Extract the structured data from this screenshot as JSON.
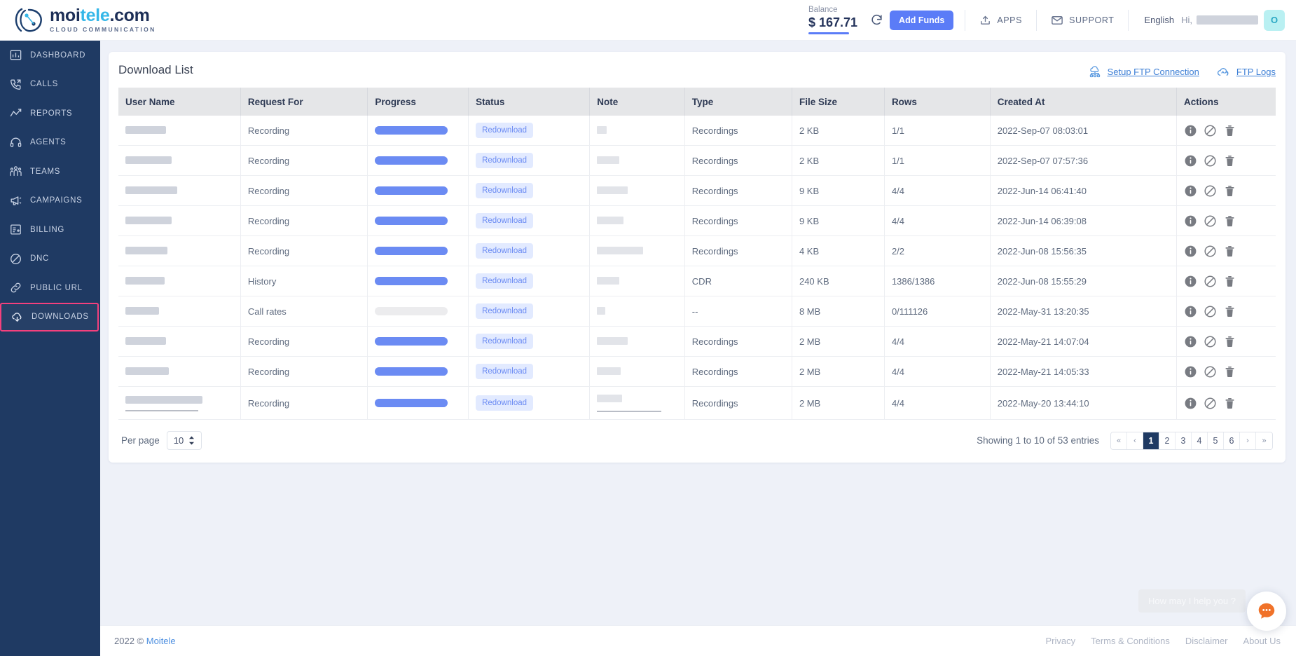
{
  "header": {
    "brand": {
      "name_part1": "moi",
      "name_part2": "tele",
      "name_part3": ".com",
      "tagline": "CLOUD COMMUNICATION"
    },
    "balance_label": "Balance",
    "balance_value": "$ 167.71",
    "refresh_icon": "refresh-icon",
    "add_funds_label": "Add Funds",
    "apps_label": "APPS",
    "apps_icon": "apps-upload-icon",
    "support_label": "SUPPORT",
    "support_icon": "envelope-icon",
    "language": "English",
    "greeting": "Hi,",
    "avatar_initial": "O",
    "accent_color": "#5b7cf7",
    "avatar_bg": "#b9f0f2"
  },
  "sidebar": {
    "active_highlight_color": "#f4407d",
    "background": "#1f3a63",
    "items": [
      {
        "label": "DASHBOARD",
        "icon": "dashboard-chart-icon",
        "active": false
      },
      {
        "label": "CALLS",
        "icon": "phone-call-icon",
        "active": false
      },
      {
        "label": "REPORTS",
        "icon": "line-chart-icon",
        "active": false
      },
      {
        "label": "AGENTS",
        "icon": "headset-icon",
        "active": false
      },
      {
        "label": "TEAMS",
        "icon": "people-group-icon",
        "active": false
      },
      {
        "label": "CAMPAIGNS",
        "icon": "megaphone-icon",
        "active": false
      },
      {
        "label": "BILLING",
        "icon": "invoice-icon",
        "active": false
      },
      {
        "label": "DNC",
        "icon": "ban-circle-icon",
        "active": false
      },
      {
        "label": "PUBLIC URL",
        "icon": "link-chain-icon",
        "active": false
      },
      {
        "label": "DOWNLOADS",
        "icon": "cloud-download-icon",
        "active": true
      }
    ]
  },
  "main": {
    "card_title": "Download List",
    "ftp_setup_label": "Setup FTP Connection",
    "ftp_setup_icon": "ftp-server-icon",
    "ftp_logs_label": "FTP Logs",
    "ftp_logs_icon": "cloud-sync-icon",
    "columns": [
      "User Name",
      "Request For",
      "Progress",
      "Status",
      "Note",
      "Type",
      "File Size",
      "Rows",
      "Created At",
      "Actions"
    ],
    "row_actions": [
      {
        "icon": "info-circle-icon",
        "title": "Info"
      },
      {
        "icon": "ban-circle-icon",
        "title": "Cancel"
      },
      {
        "icon": "trash-bin-icon",
        "title": "Delete"
      }
    ],
    "rows": [
      {
        "user_name": "",
        "user_redacted": true,
        "request_for": "Recording",
        "progress_percent": 100,
        "status": "Redownload",
        "note": "",
        "note_redacted": true,
        "type": "Recordings",
        "file_size": "2 KB",
        "rows": "1/1",
        "created_at": "2022-Sep-07 08:03:01"
      },
      {
        "user_name": "",
        "user_redacted": true,
        "request_for": "Recording",
        "progress_percent": 100,
        "status": "Redownload",
        "note": "",
        "note_redacted": true,
        "type": "Recordings",
        "file_size": "2 KB",
        "rows": "1/1",
        "created_at": "2022-Sep-07 07:57:36"
      },
      {
        "user_name": "",
        "user_redacted": true,
        "request_for": "Recording",
        "progress_percent": 100,
        "status": "Redownload",
        "note": "",
        "note_redacted": true,
        "type": "Recordings",
        "file_size": "9 KB",
        "rows": "4/4",
        "created_at": "2022-Jun-14 06:41:40"
      },
      {
        "user_name": "",
        "user_redacted": true,
        "request_for": "Recording",
        "progress_percent": 100,
        "status": "Redownload",
        "note": "",
        "note_redacted": true,
        "type": "Recordings",
        "file_size": "9 KB",
        "rows": "4/4",
        "created_at": "2022-Jun-14 06:39:08"
      },
      {
        "user_name": "",
        "user_redacted": true,
        "request_for": "Recording",
        "progress_percent": 100,
        "status": "Redownload",
        "note": "",
        "note_redacted": true,
        "type": "Recordings",
        "file_size": "4 KB",
        "rows": "2/2",
        "created_at": "2022-Jun-08 15:56:35"
      },
      {
        "user_name": "",
        "user_redacted": true,
        "request_for": "History",
        "progress_percent": 100,
        "status": "Redownload",
        "note": "",
        "note_redacted": true,
        "type": "CDR",
        "file_size": "240 KB",
        "rows": "1386/1386",
        "created_at": "2022-Jun-08 15:55:29"
      },
      {
        "user_name": "",
        "user_redacted": true,
        "request_for": "Call rates",
        "progress_percent": 0,
        "status": "Redownload",
        "note": "",
        "note_redacted": true,
        "type": "--",
        "file_size": "8 MB",
        "rows": "0/111126",
        "created_at": "2022-May-31 13:20:35"
      },
      {
        "user_name": "",
        "user_redacted": true,
        "request_for": "Recording",
        "progress_percent": 100,
        "status": "Redownload",
        "note": "",
        "note_redacted": true,
        "type": "Recordings",
        "file_size": "2 MB",
        "rows": "4/4",
        "created_at": "2022-May-21 14:07:04"
      },
      {
        "user_name": "",
        "user_redacted": true,
        "request_for": "Recording",
        "progress_percent": 100,
        "status": "Redownload",
        "note": "",
        "note_redacted": true,
        "type": "Recordings",
        "file_size": "2 MB",
        "rows": "4/4",
        "created_at": "2022-May-21 14:05:33"
      },
      {
        "user_name": "",
        "user_redacted": true,
        "request_for": "Recording",
        "progress_percent": 100,
        "status": "Redownload",
        "note": "",
        "note_redacted": true,
        "type": "Recordings",
        "file_size": "2 MB",
        "rows": "4/4",
        "created_at": "2022-May-20 13:44:10"
      }
    ],
    "pagination": {
      "per_page_label": "Per page",
      "per_page_value": "10",
      "showing_text": "Showing 1 to 10 of 53 entries",
      "first_label": "«",
      "prev_label": "‹",
      "pages": [
        "1",
        "2",
        "3",
        "4",
        "5",
        "6"
      ],
      "current_page": "1",
      "next_label": "›",
      "last_label": "»"
    }
  },
  "footer": {
    "copyright": "2022 ©",
    "company": "Moitele",
    "links": [
      "Privacy",
      "Terms & Conditions",
      "Disclaimer",
      "About Us"
    ]
  },
  "chat": {
    "tooltip": "How may I help you ?",
    "icon": "chat-bubble-icon",
    "color": "#f07229"
  }
}
